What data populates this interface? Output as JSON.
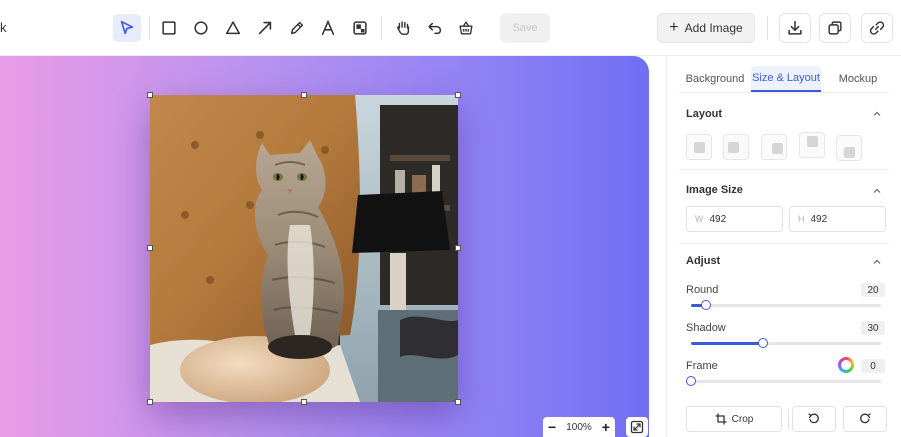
{
  "toolbar": {
    "left_text": "k",
    "tools": [
      {
        "name": "select-icon",
        "active": true
      },
      {
        "name": "rectangle-icon"
      },
      {
        "name": "circle-icon"
      },
      {
        "name": "triangle-icon"
      },
      {
        "name": "arrow-icon"
      },
      {
        "name": "pen-icon"
      },
      {
        "name": "text-icon"
      },
      {
        "name": "fill-icon"
      },
      {
        "name": "hand-icon"
      },
      {
        "name": "undo-icon"
      },
      {
        "name": "clear-icon"
      }
    ],
    "save_label": "Save",
    "add_image_label": "Add Image",
    "right_icons": [
      "download-icon",
      "copy-icon",
      "link-icon"
    ]
  },
  "canvas": {
    "zoom_label": "100%",
    "minus_label": "−",
    "plus_label": "+"
  },
  "panel": {
    "tabs": [
      {
        "label": "Background",
        "active": false
      },
      {
        "label": "Size & Layout",
        "active": true
      },
      {
        "label": "Mockup",
        "active": false
      }
    ],
    "layout": {
      "title": "Layout",
      "options": [
        "center",
        "top-left",
        "bottom-right",
        "top",
        "bottom"
      ]
    },
    "image_size": {
      "title": "Image Size",
      "width_label": "W",
      "width_value": "492",
      "height_label": "H",
      "height_value": "492"
    },
    "adjust": {
      "title": "Adjust",
      "round_label": "Round",
      "round_value": "20",
      "round_fraction": 0.08,
      "shadow_label": "Shadow",
      "shadow_value": "30",
      "shadow_fraction": 0.38,
      "frame_label": "Frame",
      "frame_value": "0",
      "frame_fraction": 0.0
    },
    "crop_label": "Crop"
  },
  "colors": {
    "accent": "#3b5bdb",
    "gradient_start": "#e99ce6",
    "gradient_end": "#6f6ff2"
  }
}
